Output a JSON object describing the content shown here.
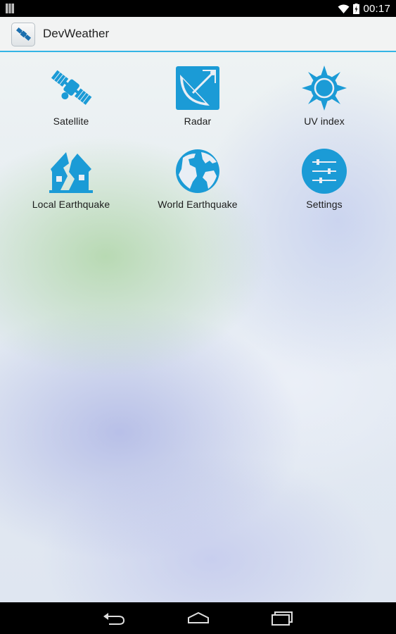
{
  "status_bar": {
    "time": "00:17",
    "icons": [
      "notification-icon",
      "wifi-icon",
      "battery-charging-icon"
    ]
  },
  "action_bar": {
    "title": "DevWeather",
    "app_icon": "satellite-icon"
  },
  "accent_color": "#33b5e5",
  "icon_color": "#1b9bd6",
  "tiles": [
    {
      "label": "Satellite",
      "icon": "satellite-icon"
    },
    {
      "label": "Radar",
      "icon": "radar-dish-icon"
    },
    {
      "label": "UV index",
      "icon": "sun-icon"
    },
    {
      "label": "Local Earthquake",
      "icon": "broken-house-icon"
    },
    {
      "label": "World Earthquake",
      "icon": "globe-icon"
    },
    {
      "label": "Settings",
      "icon": "sliders-icon"
    }
  ],
  "nav_bar": {
    "buttons": [
      "back-icon",
      "home-icon",
      "recent-apps-icon"
    ]
  }
}
